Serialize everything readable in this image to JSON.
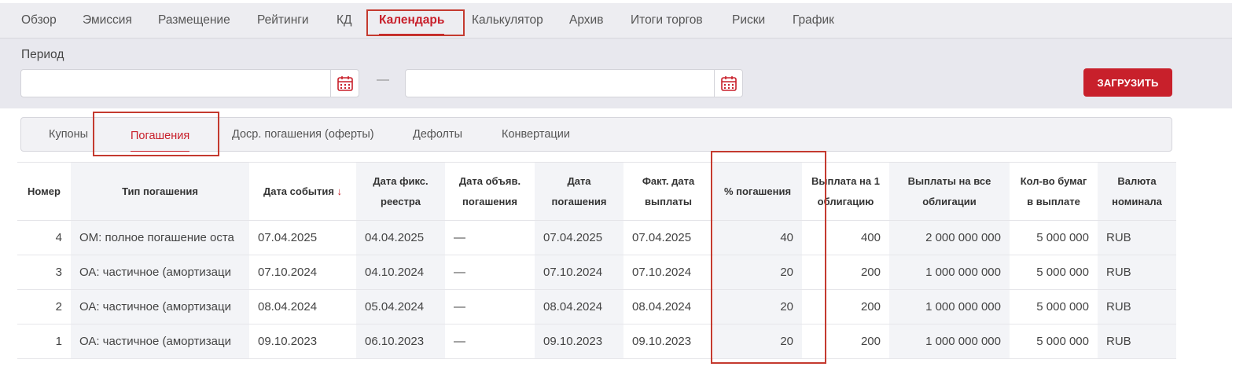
{
  "nav": {
    "tabs": [
      "Обзор",
      "Эмиссия",
      "Размещение",
      "Рейтинги",
      "КД",
      "Календарь",
      "Калькулятор",
      "Архив",
      "Итоги торгов",
      "Риски",
      "График"
    ],
    "active": "Календарь"
  },
  "period": {
    "label": "Период",
    "from_value": "",
    "to_value": "",
    "separator": "—",
    "load_button": "ЗАГРУЗИТЬ"
  },
  "subtabs": {
    "items": [
      "Купоны",
      "Погашения",
      "Доср. погашения (оферты)",
      "Дефолты",
      "Конвертации"
    ],
    "active": "Погашения"
  },
  "table": {
    "headers": {
      "number": "Номер",
      "type": "Тип погашения",
      "event_date": "Дата события",
      "event_date_sort": "↓",
      "record_date_1": "Дата фикс.",
      "record_date_2": "реестра",
      "announce_1": "Дата объяв.",
      "announce_2": "погашения",
      "redemption_1": "Дата",
      "redemption_2": "погашения",
      "actual_1": "Факт. дата",
      "actual_2": "выплаты",
      "pct": "% погашения",
      "per_bond_1": "Выплата на 1",
      "per_bond_2": "облигацию",
      "total_1": "Выплаты на все",
      "total_2": "облигации",
      "qty_1": "Кол-во бумаг",
      "qty_2": "в выплате",
      "currency_1": "Валюта",
      "currency_2": "номинала"
    },
    "rows": [
      {
        "number": "4",
        "type": "ОМ: полное погашение оста",
        "event_date": "07.04.2025",
        "record_date": "04.04.2025",
        "announce": "—",
        "redemption": "07.04.2025",
        "actual": "07.04.2025",
        "pct": "40",
        "per_bond": "400",
        "total": "2 000 000 000",
        "qty": "5 000 000",
        "currency": "RUB"
      },
      {
        "number": "3",
        "type": "ОА: частичное (амортизаци",
        "event_date": "07.10.2024",
        "record_date": "04.10.2024",
        "announce": "—",
        "redemption": "07.10.2024",
        "actual": "07.10.2024",
        "pct": "20",
        "per_bond": "200",
        "total": "1 000 000 000",
        "qty": "5 000 000",
        "currency": "RUB"
      },
      {
        "number": "2",
        "type": "ОА: частичное (амортизаци",
        "event_date": "08.04.2024",
        "record_date": "05.04.2024",
        "announce": "—",
        "redemption": "08.04.2024",
        "actual": "08.04.2024",
        "pct": "20",
        "per_bond": "200",
        "total": "1 000 000 000",
        "qty": "5 000 000",
        "currency": "RUB"
      },
      {
        "number": "1",
        "type": "ОА: частичное (амортизаци",
        "event_date": "09.10.2023",
        "record_date": "06.10.2023",
        "announce": "—",
        "redemption": "09.10.2023",
        "actual": "09.10.2023",
        "pct": "20",
        "per_bond": "200",
        "total": "1 000 000 000",
        "qty": "5 000 000",
        "currency": "RUB"
      }
    ]
  },
  "colors": {
    "accent": "#c8202b",
    "highlight": "#c43a2f",
    "panel": "#e8e8ee"
  }
}
